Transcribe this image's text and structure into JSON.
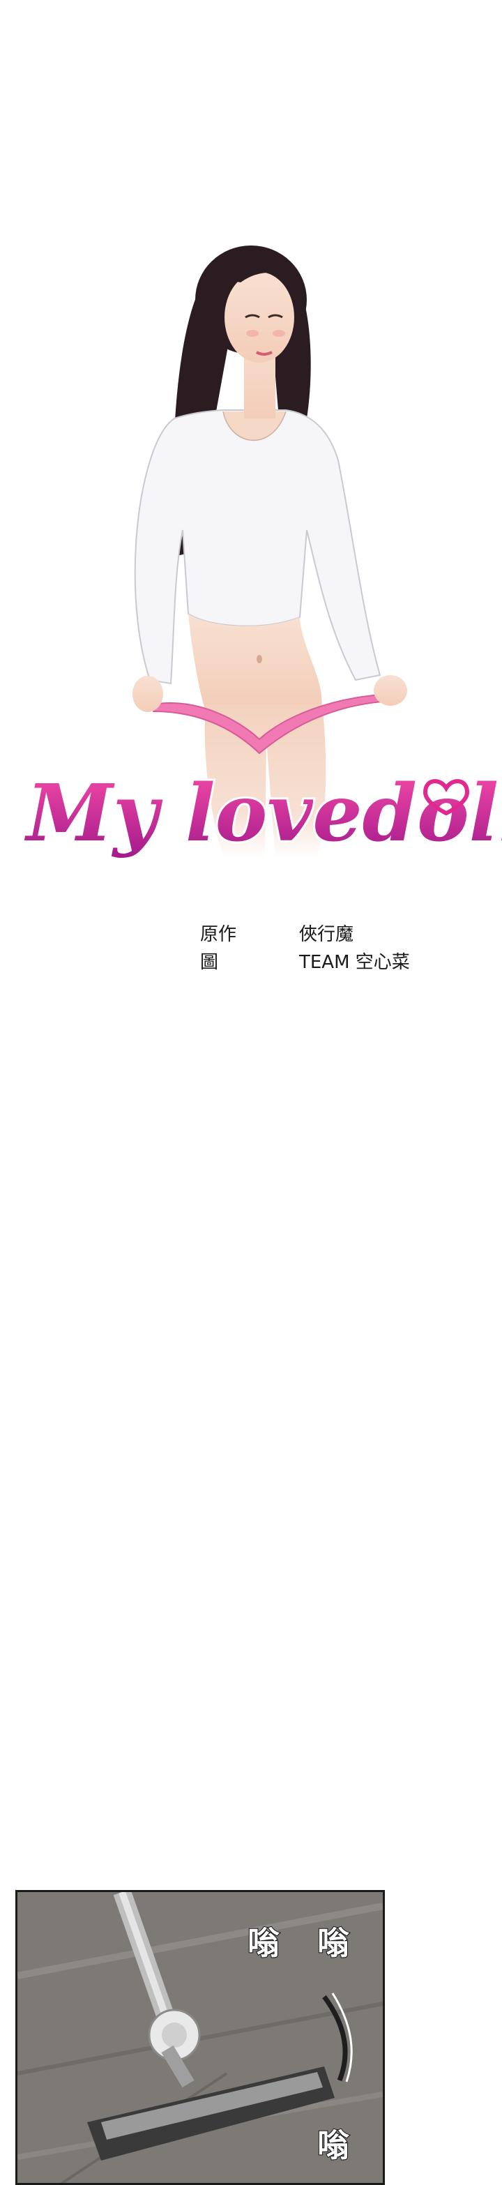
{
  "logo": {
    "title": "My lovedoll"
  },
  "credits": [
    {
      "role": "原作",
      "name": "俠行魔"
    },
    {
      "role": "圖",
      "name": "TEAM 空心菜"
    }
  ],
  "panel": {
    "sfx": [
      "嗡",
      "嗡",
      "嗡"
    ]
  },
  "colors": {
    "logo_pink": "#e0288e",
    "logo_purple": "#9a2a9a",
    "hair": "#2a1c20",
    "shirt": "#f6f6f8",
    "skin": "#f6d8c6",
    "panties": "#f27ab4",
    "floor": "#7d7a76"
  }
}
